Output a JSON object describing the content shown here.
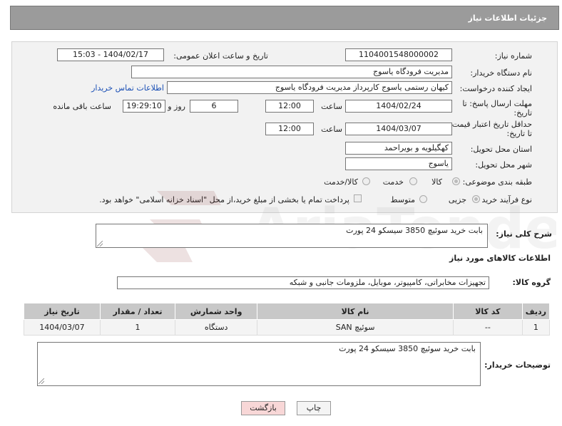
{
  "header": {
    "title": "جزئیات اطلاعات نیاز"
  },
  "form": {
    "need_number_label": "شماره نیاز:",
    "need_number": "1104001548000002",
    "announce_label": "تاریخ و ساعت اعلان عمومی:",
    "announce_value": "1404/02/17 - 15:03",
    "buyer_org_label": "نام دستگاه خریدار:",
    "buyer_org": "مدیریت فرودگاه یاسوج",
    "creator_label": "ایجاد کننده درخواست:",
    "creator": "کیهان رستمی یاسوج کارپرداز مدیریت فرودگاه یاسوج",
    "contact_link": "اطلاعات تماس خریدار",
    "deadline_label_1": "مهلت ارسال پاسخ: تا",
    "deadline_label_2": "تاریخ:",
    "deadline_date": "1404/02/24",
    "time_label": "ساعت",
    "deadline_time": "12:00",
    "days_value": "6",
    "days_label": "روز و",
    "remaining_time": "19:29:10",
    "remaining_label": "ساعت باقی مانده",
    "validity_label_1": "حداقل تاریخ اعتبار قیمت:",
    "validity_label_2": "تا تاریخ:",
    "validity_date": "1404/03/07",
    "validity_time": "12:00",
    "province_label": "استان محل تحویل:",
    "province": "کهگیلویه و بویراحمد",
    "city_label": "شهر محل تحویل:",
    "city": "یاسوج",
    "category_label": "طبقه بندی موضوعی:",
    "category_options": [
      "کالا",
      "خدمت",
      "کالا/خدمت"
    ],
    "process_label": "نوع فرآیند خرید :",
    "process_options": [
      "جزیی",
      "متوسط"
    ],
    "payment_note": "پرداخت تمام یا بخشی از مبلغ خرید،از محل \"اسناد خزانه اسلامی\" خواهد بود."
  },
  "description": {
    "label": "شرح کلی نیاز:",
    "value": "بابت خرید سوئیچ  3850 سیسکو 24 پورت"
  },
  "goods_section": {
    "title": "اطلاعات کالاهای مورد نیاز",
    "group_label": "گروه کالا:",
    "group_value": "تجهیزات مخابراتی، کامپیوتر، موبایل، ملزومات جانبی و شبکه"
  },
  "table": {
    "headers": [
      "ردیف",
      "کد کالا",
      "نام کالا",
      "واحد شمارش",
      "تعداد / مقدار",
      "تاریخ نیاز"
    ],
    "rows": [
      [
        "1",
        "--",
        "سوئیچ SAN",
        "دستگاه",
        "1",
        "1404/03/07"
      ]
    ]
  },
  "buyer_notes": {
    "label": "توضیحات خریدار:",
    "value": "بابت خرید سوئیچ  3850 سیسکو 24 پورت"
  },
  "buttons": {
    "print": "چاپ",
    "back": "بازگشت"
  },
  "watermark": {
    "text": "AriaTender.neT"
  },
  "colors": {
    "header_bg": "#9b9b9b",
    "link": "#1a4fb5",
    "back_button": "#f8d7d7"
  }
}
